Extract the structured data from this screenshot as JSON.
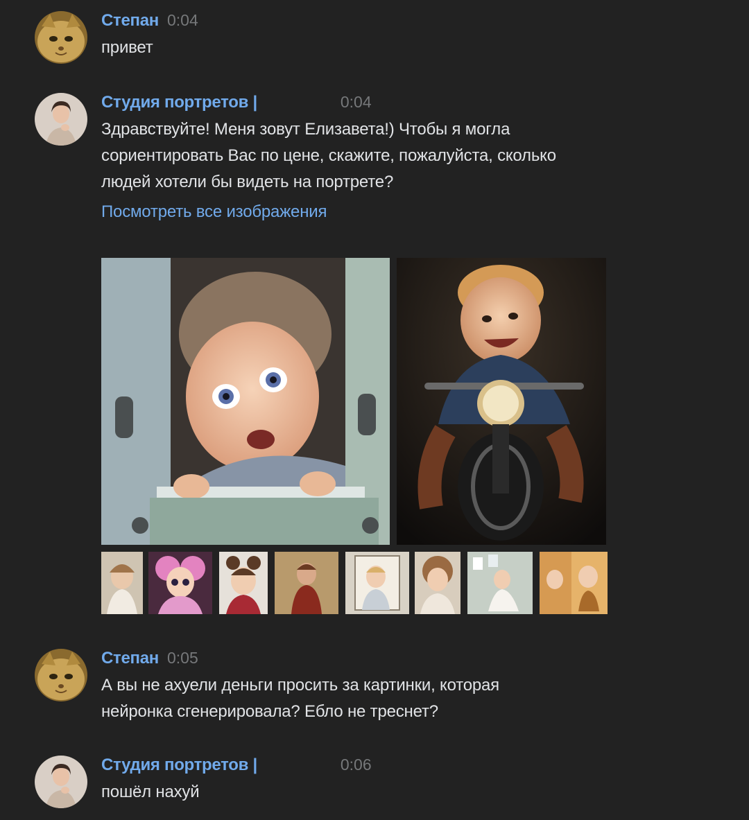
{
  "messages": [
    {
      "author": "Степан",
      "time": "0:04",
      "lines": [
        "привет"
      ]
    },
    {
      "author": "Студия портретов |",
      "time": "0:04",
      "lines": [
        "Здравствуйте! Меня зовут Елизавета!) Чтобы я могла",
        "сориентировать Вас по цене, скажите, пожалуйста, сколько",
        "людей хотели бы видеть на портрете?"
      ],
      "link": "Посмотреть все изображения",
      "photos": [
        "child-in-window-portrait",
        "child-on-motorcycle-portrait"
      ],
      "thumbnails": [
        "child-portrait-1",
        "child-portrait-2",
        "child-portrait-3",
        "child-portrait-4",
        "child-portrait-5",
        "child-portrait-6",
        "child-portrait-7",
        "child-portrait-8"
      ]
    },
    {
      "author": "Степан",
      "time": "0:05",
      "lines": [
        "А вы не ахуели деньги просить за картинки, которая",
        "нейронка сгенерировала? Ебло не треснет?"
      ]
    },
    {
      "author": "Студия портретов |",
      "time": "0:06",
      "lines": [
        "пошёл нахуй"
      ]
    }
  ],
  "colors": {
    "background": "#222222",
    "author": "#71aaeb",
    "text": "#e1e3e6",
    "time": "#76787a",
    "link": "#71aaeb"
  }
}
